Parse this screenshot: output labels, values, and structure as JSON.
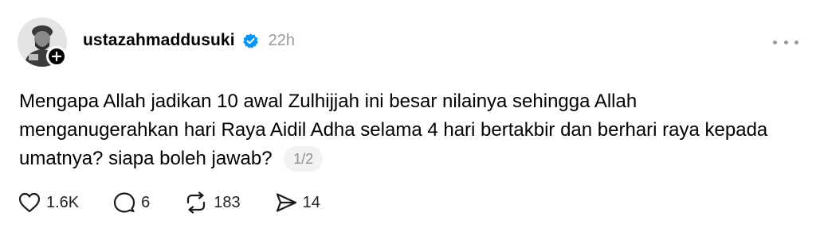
{
  "post": {
    "username": "ustazahmaddusuki",
    "time": "22h",
    "text": "Mengapa Allah jadikan 10 awal Zulhijjah ini besar nilainya sehingga Allah menganugerahkan hari Raya Aidil Adha selama 4 hari bertakbir dan berhari raya kepada umatnya? siapa boleh jawab?",
    "page_indicator": "1/2",
    "verified_color": "#0095f6"
  },
  "actions": {
    "likes": "1.6K",
    "comments": "6",
    "reposts": "183",
    "shares": "14"
  },
  "icons": {
    "like": "heart-icon",
    "comment": "comment-bubble-icon",
    "repost": "repost-icon",
    "share": "send-icon",
    "more": "more-options-icon",
    "follow": "plus-icon",
    "verified": "verified-badge-icon"
  }
}
